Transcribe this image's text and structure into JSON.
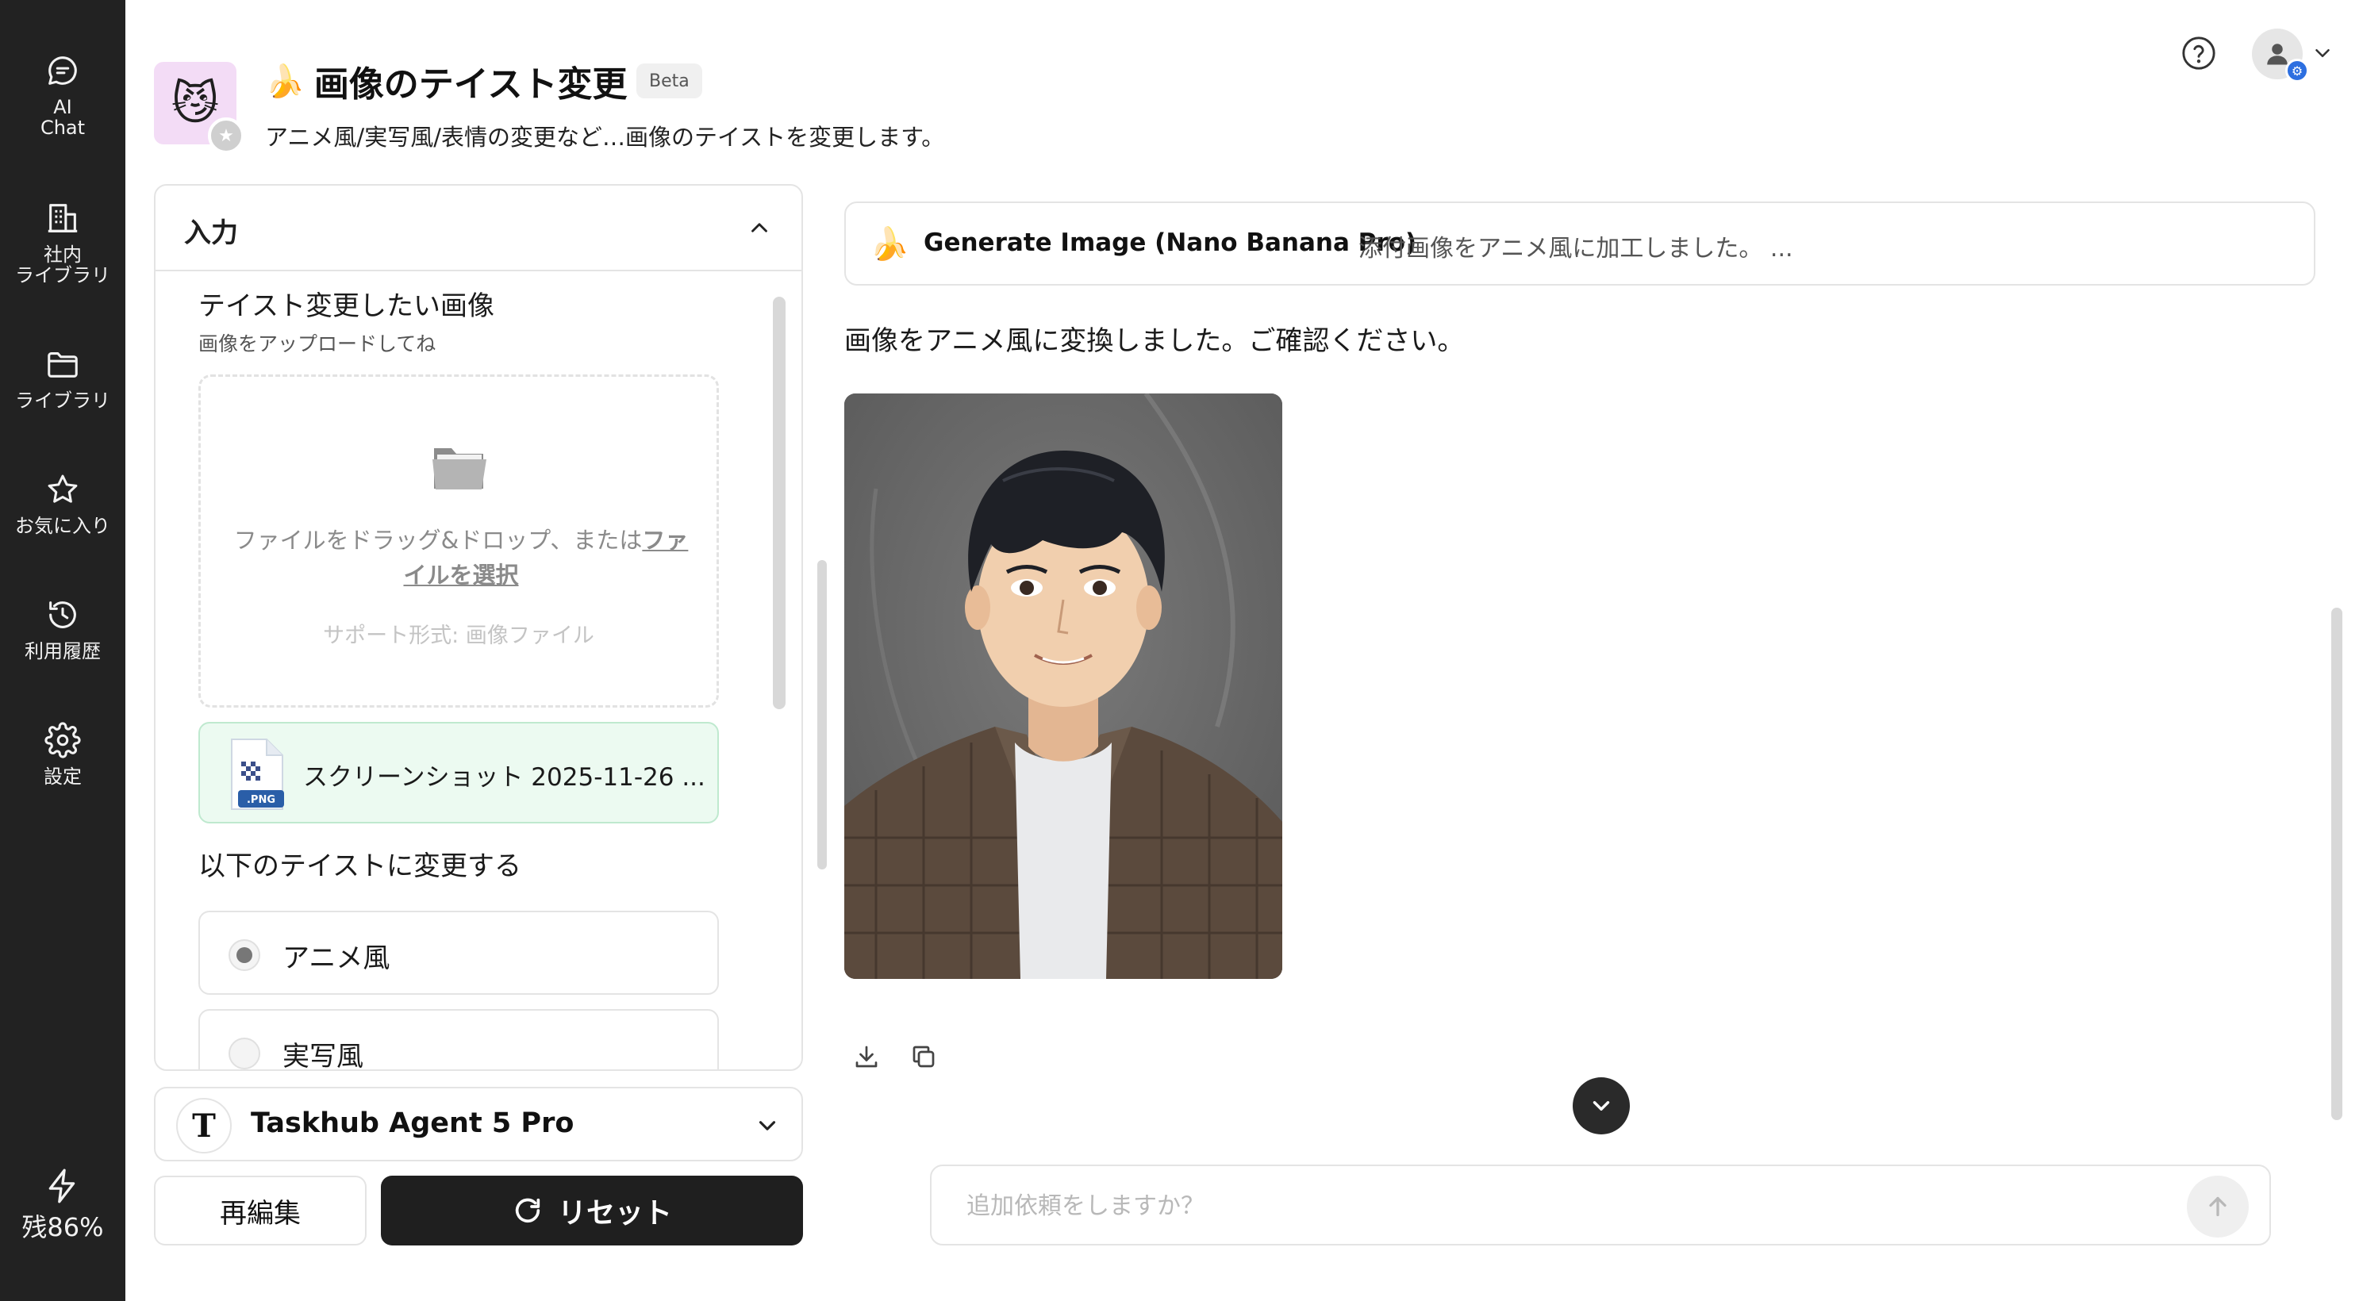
{
  "sidebar": {
    "items": [
      {
        "label": "AI\nChat",
        "icon": "chat-bubble-icon"
      },
      {
        "label": "社内\nライブラリ",
        "icon": "building-icon"
      },
      {
        "label": "ライブラリ",
        "icon": "folder-icon"
      },
      {
        "label": "お気に入り",
        "icon": "star-icon"
      },
      {
        "label": "利用履歴",
        "icon": "history-icon"
      },
      {
        "label": "設定",
        "icon": "gear-icon"
      }
    ],
    "credit": {
      "label": "残86%",
      "icon": "lightning-icon"
    }
  },
  "header": {
    "avatar_emoji": "😼",
    "title_emoji": "🍌",
    "title": "画像のテイスト変更",
    "badge": "Beta",
    "subtitle": "アニメ風/実写風/表情の変更など…画像のテイストを変更します。"
  },
  "input_panel": {
    "title": "入力",
    "image_field": {
      "label": "テイスト変更したい画像",
      "hint": "画像をアップロードしてね",
      "dropzone_text_before": "ファイルをドラッグ&ドロップ、または",
      "dropzone_link": "ファイルを選択",
      "support": "サポート形式: 画像ファイル"
    },
    "uploaded_file": {
      "name": "スクリーンショット 2025-11-26 ...",
      "ext": ".PNG"
    },
    "taste_field": {
      "label": "以下のテイストに変更する",
      "options": [
        {
          "label": "アニメ風",
          "selected": true
        },
        {
          "label": "実写風",
          "selected": false
        }
      ]
    }
  },
  "model": {
    "logo_letter": "T",
    "name": "Taskhub Agent 5 Pro"
  },
  "actions": {
    "reedit": "再編集",
    "reset": "リセット"
  },
  "output": {
    "tool_emoji": "🍌",
    "tool_name": "Generate Image (Nano Banana Pro)",
    "tool_desc": "添付画像をアニメ風に加工しました。 ...",
    "message": "画像をアニメ風に変換しました。ご確認ください。"
  },
  "followup": {
    "placeholder": "追加依頼をしますか？"
  },
  "colors": {
    "sidebar_bg": "#222222",
    "primary_button": "#1f1f1f",
    "file_chip_bg": "#ecfaf1",
    "user_badge": "#2d6fe0"
  }
}
